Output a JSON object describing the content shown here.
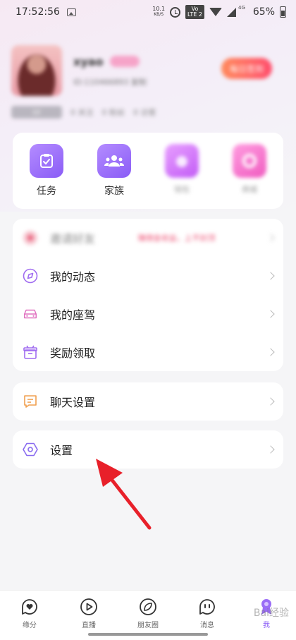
{
  "status_bar": {
    "time": "17:52:56",
    "net_speed": "10.1",
    "net_unit": "KB/S",
    "volte_top": "Vo",
    "volte_bottom": "LTE 2",
    "signal_label": "4G",
    "battery": "65%"
  },
  "profile": {
    "nickname": "xyao",
    "user_id": "ID:110466893",
    "id_suffix": "复制",
    "checkin": "每日签到",
    "level": "LV",
    "stats": [
      "0 关注",
      "0 粉丝",
      "0 访客"
    ]
  },
  "features": [
    {
      "label": "任务",
      "icon": "clipboard-check-icon",
      "faded": false
    },
    {
      "label": "家族",
      "icon": "group-icon",
      "faded": false
    },
    {
      "label": "钱包",
      "icon": "wallet-icon",
      "faded": true
    },
    {
      "label": "商城",
      "icon": "store-icon",
      "faded": true
    }
  ],
  "menu": {
    "invite_label": "邀请好友",
    "invite_note": "赚佣金收益，上不封顶",
    "moments": "我的动态",
    "vehicle": "我的座驾",
    "rewards": "奖励领取",
    "chat_settings": "聊天设置",
    "settings": "设置"
  },
  "bottom_nav": {
    "items": [
      {
        "label": "缘分",
        "icon": "heart-chat-icon"
      },
      {
        "label": "直播",
        "icon": "play-icon"
      },
      {
        "label": "朋友圈",
        "icon": "leaf-icon"
      },
      {
        "label": "消息",
        "icon": "message-icon"
      },
      {
        "label": "我",
        "icon": "mascot-icon"
      }
    ]
  },
  "watermark": "Bai经验",
  "colors": {
    "accent": "#8a5cf6",
    "arrow": "#e8202a",
    "background": "#f5f5f7"
  }
}
